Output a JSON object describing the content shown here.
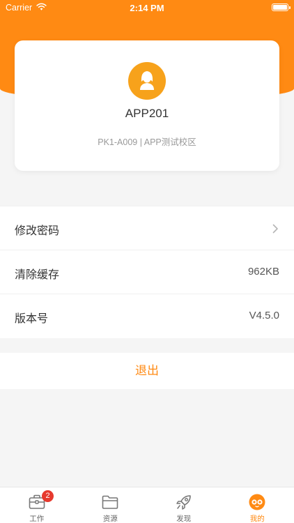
{
  "status_bar": {
    "carrier": "Carrier",
    "time": "2:14 PM"
  },
  "profile": {
    "name": "APP201",
    "school": "PK1-A009 | APP测试校区"
  },
  "menu": {
    "items": [
      {
        "label": "修改密码",
        "value": ""
      },
      {
        "label": "清除缓存",
        "value": "962KB"
      },
      {
        "label": "版本号",
        "value": "V4.5.0"
      }
    ]
  },
  "logout_label": "退出",
  "tabbar": {
    "tabs": [
      {
        "label": "工作",
        "icon": "briefcase-icon",
        "badge": "2"
      },
      {
        "label": "资源",
        "icon": "folder-icon"
      },
      {
        "label": "发现",
        "icon": "rocket-icon"
      },
      {
        "label": "我的",
        "icon": "owl-face-icon"
      }
    ],
    "active_index": 3
  },
  "colors": {
    "accent": "#ff8a13",
    "badge": "#e63a2e",
    "avatar_bg": "#f7a21b"
  }
}
